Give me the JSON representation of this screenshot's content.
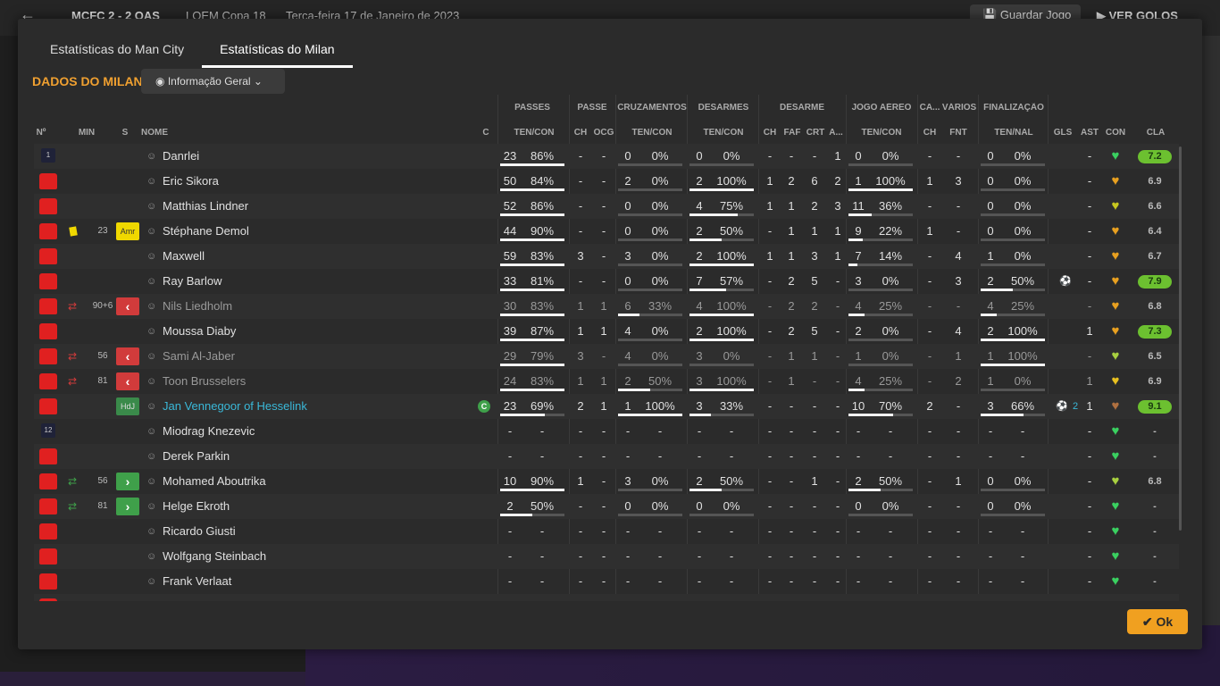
{
  "topbar": {
    "back_icon": "back-arrow-icon",
    "score": "MCFC  2 - 2  OAS",
    "competition": "LOEM Copa 18",
    "date": "Terça-feira 17 de Janeiro de 2023",
    "save_label": "Guardar Jogo",
    "goals_label": "VER GOLOS"
  },
  "tabs": [
    {
      "label": "Estatísticas do Man City",
      "active": false
    },
    {
      "label": "Estatísticas do Milan",
      "active": true
    }
  ],
  "section_title": "DADOS DO MILAN",
  "view_select": {
    "value": "Informação Geral",
    "icon": "eye-icon"
  },
  "groups": [
    "PASSES",
    "PASSE",
    "CRUZAMENTOS",
    "DESARMES",
    "DESARME",
    "JOGO AÉREO",
    "CA...",
    "VÁRIOS",
    "FINALIZAÇÃO"
  ],
  "columns": [
    "Nº",
    "MIN",
    "S",
    "NOME",
    "C",
    "TEN/CON",
    "CH",
    "OCG",
    "TEN/CON",
    "TEN/CON",
    "CH",
    "FAF",
    "CRT",
    "A...",
    "TEN/CON",
    "CH",
    "FNT",
    "TEN/NAL",
    "GLS",
    "AST",
    "CON",
    "CLA"
  ],
  "colors": {
    "accent": "#f0a030",
    "shirt": "#e02020",
    "sub_out": "#d13b3b",
    "sub_in": "#3fa04a",
    "rating_high": "#6cc030",
    "link": "#3ab8d8"
  },
  "players": [
    {
      "num": "1",
      "kit": "gk",
      "card": "",
      "min": "",
      "sub": "",
      "tag": "",
      "name": "Danrlei",
      "cap": "",
      "p": [
        "23",
        "86%"
      ],
      "ch": "-",
      "ocg": "-",
      "cr": [
        "0",
        "0%"
      ],
      "ds": [
        "0",
        "0%"
      ],
      "d": [
        "-",
        "-",
        "-",
        "1"
      ],
      "ja": [
        "0",
        "0%"
      ],
      "ca": "-",
      "fnt": "-",
      "fi": [
        "0",
        "0%"
      ],
      "gls": "",
      "ast": "-",
      "con": "#3ad060",
      "cla": "7.2",
      "cla_hi": true,
      "pb": 1,
      "crb": 0,
      "dsb": 0,
      "jab": 0,
      "fib": 0
    },
    {
      "num": "",
      "kit": "shirt",
      "card": "",
      "min": "",
      "sub": "",
      "tag": "",
      "name": "Eric Sikora",
      "cap": "",
      "p": [
        "50",
        "84%"
      ],
      "ch": "-",
      "ocg": "-",
      "cr": [
        "2",
        "0%"
      ],
      "ds": [
        "2",
        "100%"
      ],
      "d": [
        "1",
        "2",
        "6",
        "2"
      ],
      "ja": [
        "1",
        "100%"
      ],
      "ca": "1",
      "fnt": "3",
      "fi": [
        "0",
        "0%"
      ],
      "gls": "",
      "ast": "-",
      "con": "#e8a020",
      "cla": "6.9",
      "cla_hi": false,
      "pb": 1,
      "crb": 0,
      "dsb": 1,
      "jab": 1,
      "fib": 0
    },
    {
      "num": "",
      "kit": "shirt",
      "card": "",
      "min": "",
      "sub": "",
      "tag": "",
      "name": "Matthias Lindner",
      "cap": "",
      "p": [
        "52",
        "86%"
      ],
      "ch": "-",
      "ocg": "-",
      "cr": [
        "0",
        "0%"
      ],
      "ds": [
        "4",
        "75%"
      ],
      "d": [
        "1",
        "1",
        "2",
        "3"
      ],
      "ja": [
        "11",
        "36%"
      ],
      "ca": "-",
      "fnt": "-",
      "fi": [
        "0",
        "0%"
      ],
      "gls": "",
      "ast": "-",
      "con": "#c8c820",
      "cla": "6.6",
      "cla_hi": false,
      "pb": 1,
      "crb": 0,
      "dsb": 0.75,
      "jab": 0.36,
      "fib": 0
    },
    {
      "num": "",
      "kit": "shirt",
      "card": "yellow",
      "min": "23",
      "sub": "",
      "tag": "Amr",
      "name": "Stéphane Demol",
      "cap": "",
      "p": [
        "44",
        "90%"
      ],
      "ch": "-",
      "ocg": "-",
      "cr": [
        "0",
        "0%"
      ],
      "ds": [
        "2",
        "50%"
      ],
      "d": [
        "-",
        "1",
        "1",
        "1"
      ],
      "ja": [
        "9",
        "22%"
      ],
      "ca": "1",
      "fnt": "-",
      "fi": [
        "0",
        "0%"
      ],
      "gls": "",
      "ast": "-",
      "con": "#e8a020",
      "cla": "6.4",
      "cla_hi": false,
      "pb": 1,
      "crb": 0,
      "dsb": 0.5,
      "jab": 0.22,
      "fib": 0
    },
    {
      "num": "",
      "kit": "shirt",
      "card": "",
      "min": "",
      "sub": "",
      "tag": "",
      "name": "Maxwell",
      "cap": "",
      "p": [
        "59",
        "83%"
      ],
      "ch": "3",
      "ocg": "-",
      "cr": [
        "3",
        "0%"
      ],
      "ds": [
        "2",
        "100%"
      ],
      "d": [
        "1",
        "1",
        "3",
        "1"
      ],
      "ja": [
        "7",
        "14%"
      ],
      "ca": "-",
      "fnt": "4",
      "fi": [
        "1",
        "0%"
      ],
      "gls": "",
      "ast": "-",
      "con": "#e8a020",
      "cla": "6.7",
      "cla_hi": false,
      "pb": 1,
      "crb": 0,
      "dsb": 1,
      "jab": 0.14,
      "fib": 0
    },
    {
      "num": "",
      "kit": "shirt",
      "card": "",
      "min": "",
      "sub": "",
      "tag": "",
      "name": "Ray Barlow",
      "cap": "",
      "p": [
        "33",
        "81%"
      ],
      "ch": "-",
      "ocg": "-",
      "cr": [
        "0",
        "0%"
      ],
      "ds": [
        "7",
        "57%"
      ],
      "d": [
        "-",
        "2",
        "5",
        "-"
      ],
      "ja": [
        "3",
        "0%"
      ],
      "ca": "-",
      "fnt": "3",
      "fi": [
        "2",
        "50%"
      ],
      "gls": "ball",
      "ast": "-",
      "con": "#e8a020",
      "cla": "7.9",
      "cla_hi": true,
      "pb": 1,
      "crb": 0,
      "dsb": 0.57,
      "jab": 0,
      "fib": 0.5
    },
    {
      "num": "",
      "kit": "shirt",
      "card": "",
      "min": "90+6",
      "sub": "out",
      "tag": "",
      "name": "Nils Liedholm",
      "cap": "",
      "p": [
        "30",
        "83%"
      ],
      "ch": "1",
      "ocg": "1",
      "cr": [
        "6",
        "33%"
      ],
      "ds": [
        "4",
        "100%"
      ],
      "d": [
        "-",
        "2",
        "2",
        "-"
      ],
      "ja": [
        "4",
        "25%"
      ],
      "ca": "-",
      "fnt": "-",
      "fi": [
        "4",
        "25%"
      ],
      "gls": "",
      "ast": "-",
      "con": "#e8a020",
      "cla": "6.8",
      "cla_hi": false,
      "pb": 1,
      "crb": 0.33,
      "dsb": 1,
      "jab": 0.25,
      "fib": 0.25,
      "dim": true
    },
    {
      "num": "",
      "kit": "shirt",
      "card": "",
      "min": "",
      "sub": "",
      "tag": "",
      "name": "Moussa Diaby",
      "cap": "",
      "p": [
        "39",
        "87%"
      ],
      "ch": "1",
      "ocg": "1",
      "cr": [
        "4",
        "0%"
      ],
      "ds": [
        "2",
        "100%"
      ],
      "d": [
        "-",
        "2",
        "5",
        "-"
      ],
      "ja": [
        "2",
        "0%"
      ],
      "ca": "-",
      "fnt": "4",
      "fi": [
        "2",
        "100%"
      ],
      "gls": "",
      "ast": "1",
      "con": "#e8a020",
      "cla": "7.3",
      "cla_hi": true,
      "pb": 1,
      "crb": 0,
      "dsb": 1,
      "jab": 0,
      "fib": 1
    },
    {
      "num": "",
      "kit": "shirt",
      "card": "",
      "min": "56",
      "sub": "out",
      "tag": "",
      "name": "Sami Al-Jaber",
      "cap": "",
      "p": [
        "29",
        "79%"
      ],
      "ch": "3",
      "ocg": "-",
      "cr": [
        "4",
        "0%"
      ],
      "ds": [
        "3",
        "0%"
      ],
      "d": [
        "-",
        "1",
        "1",
        "-"
      ],
      "ja": [
        "1",
        "0%"
      ],
      "ca": "-",
      "fnt": "1",
      "fi": [
        "1",
        "100%"
      ],
      "gls": "",
      "ast": "-",
      "con": "#a8d040",
      "cla": "6.5",
      "cla_hi": false,
      "pb": 1,
      "crb": 0,
      "dsb": 0,
      "jab": 0,
      "fib": 1,
      "dim": true
    },
    {
      "num": "",
      "kit": "shirt",
      "card": "",
      "min": "81",
      "sub": "out",
      "tag": "",
      "name": "Toon Brusselers",
      "cap": "",
      "p": [
        "24",
        "83%"
      ],
      "ch": "1",
      "ocg": "1",
      "cr": [
        "2",
        "50%"
      ],
      "ds": [
        "3",
        "100%"
      ],
      "d": [
        "-",
        "1",
        "-",
        "-"
      ],
      "ja": [
        "4",
        "25%"
      ],
      "ca": "-",
      "fnt": "2",
      "fi": [
        "1",
        "0%"
      ],
      "gls": "",
      "ast": "1",
      "con": "#e8c020",
      "cla": "6.9",
      "cla_hi": false,
      "pb": 1,
      "crb": 0.5,
      "dsb": 1,
      "jab": 0.25,
      "fib": 0,
      "dim": true
    },
    {
      "num": "",
      "kit": "shirt",
      "card": "",
      "min": "",
      "sub": "",
      "tag": "HdJ",
      "name": "Jan Vennegoor of Hesselink",
      "cap": "C",
      "p": [
        "23",
        "69%"
      ],
      "ch": "2",
      "ocg": "1",
      "cr": [
        "1",
        "100%"
      ],
      "ds": [
        "3",
        "33%"
      ],
      "d": [
        "-",
        "-",
        "-",
        "-"
      ],
      "ja": [
        "10",
        "70%"
      ],
      "ca": "2",
      "fnt": "-",
      "fi": [
        "3",
        "66%"
      ],
      "gls": "ball2",
      "ast": "1",
      "con": "#b07040",
      "cla": "9.1",
      "cla_hi": true,
      "pb": 0.69,
      "crb": 1,
      "dsb": 0.33,
      "jab": 0.7,
      "fib": 0.66,
      "link": true
    },
    {
      "num": "12",
      "kit": "gk",
      "card": "",
      "min": "",
      "sub": "",
      "tag": "",
      "name": "Miodrag Knezevic",
      "cap": "",
      "p": [
        "-",
        "-"
      ],
      "ch": "-",
      "ocg": "-",
      "cr": [
        "-",
        "-"
      ],
      "ds": [
        "-",
        "-"
      ],
      "d": [
        "-",
        "-",
        "-",
        "-"
      ],
      "ja": [
        "-",
        "-"
      ],
      "ca": "-",
      "fnt": "-",
      "fi": [
        "-",
        "-"
      ],
      "gls": "",
      "ast": "-",
      "con": "#3ad060",
      "cla": "-",
      "cla_hi": false,
      "pb": 0,
      "crb": 0,
      "dsb": 0,
      "jab": 0,
      "fib": 0
    },
    {
      "num": "",
      "kit": "shirt",
      "card": "",
      "min": "",
      "sub": "",
      "tag": "",
      "name": "Derek Parkin",
      "cap": "",
      "p": [
        "-",
        "-"
      ],
      "ch": "-",
      "ocg": "-",
      "cr": [
        "-",
        "-"
      ],
      "ds": [
        "-",
        "-"
      ],
      "d": [
        "-",
        "-",
        "-",
        "-"
      ],
      "ja": [
        "-",
        "-"
      ],
      "ca": "-",
      "fnt": "-",
      "fi": [
        "-",
        "-"
      ],
      "gls": "",
      "ast": "-",
      "con": "#3ad060",
      "cla": "-",
      "cla_hi": false,
      "pb": 0,
      "crb": 0,
      "dsb": 0,
      "jab": 0,
      "fib": 0
    },
    {
      "num": "",
      "kit": "shirt",
      "card": "",
      "min": "56",
      "sub": "in",
      "tag": "",
      "name": "Mohamed Aboutrika",
      "cap": "",
      "p": [
        "10",
        "90%"
      ],
      "ch": "1",
      "ocg": "-",
      "cr": [
        "3",
        "0%"
      ],
      "ds": [
        "2",
        "50%"
      ],
      "d": [
        "-",
        "-",
        "1",
        "-"
      ],
      "ja": [
        "2",
        "50%"
      ],
      "ca": "-",
      "fnt": "1",
      "fi": [
        "0",
        "0%"
      ],
      "gls": "",
      "ast": "-",
      "con": "#a8d040",
      "cla": "6.8",
      "cla_hi": false,
      "pb": 1,
      "crb": 0,
      "dsb": 0.5,
      "jab": 0.5,
      "fib": 0
    },
    {
      "num": "",
      "kit": "shirt",
      "card": "",
      "min": "81",
      "sub": "in",
      "tag": "",
      "name": "Helge Ekroth",
      "cap": "",
      "p": [
        "2",
        "50%"
      ],
      "ch": "-",
      "ocg": "-",
      "cr": [
        "0",
        "0%"
      ],
      "ds": [
        "0",
        "0%"
      ],
      "d": [
        "-",
        "-",
        "-",
        "-"
      ],
      "ja": [
        "0",
        "0%"
      ],
      "ca": "-",
      "fnt": "-",
      "fi": [
        "0",
        "0%"
      ],
      "gls": "",
      "ast": "-",
      "con": "#3ad060",
      "cla": "-",
      "cla_hi": false,
      "pb": 0.5,
      "crb": 0,
      "dsb": 0,
      "jab": 0,
      "fib": 0
    },
    {
      "num": "",
      "kit": "shirt",
      "card": "",
      "min": "",
      "sub": "",
      "tag": "",
      "name": "Ricardo Giusti",
      "cap": "",
      "p": [
        "-",
        "-"
      ],
      "ch": "-",
      "ocg": "-",
      "cr": [
        "-",
        "-"
      ],
      "ds": [
        "-",
        "-"
      ],
      "d": [
        "-",
        "-",
        "-",
        "-"
      ],
      "ja": [
        "-",
        "-"
      ],
      "ca": "-",
      "fnt": "-",
      "fi": [
        "-",
        "-"
      ],
      "gls": "",
      "ast": "-",
      "con": "#3ad060",
      "cla": "-",
      "cla_hi": false,
      "pb": 0,
      "crb": 0,
      "dsb": 0,
      "jab": 0,
      "fib": 0
    },
    {
      "num": "",
      "kit": "shirt",
      "card": "",
      "min": "",
      "sub": "",
      "tag": "",
      "name": "Wolfgang Steinbach",
      "cap": "",
      "p": [
        "-",
        "-"
      ],
      "ch": "-",
      "ocg": "-",
      "cr": [
        "-",
        "-"
      ],
      "ds": [
        "-",
        "-"
      ],
      "d": [
        "-",
        "-",
        "-",
        "-"
      ],
      "ja": [
        "-",
        "-"
      ],
      "ca": "-",
      "fnt": "-",
      "fi": [
        "-",
        "-"
      ],
      "gls": "",
      "ast": "-",
      "con": "#3ad060",
      "cla": "-",
      "cla_hi": false,
      "pb": 0,
      "crb": 0,
      "dsb": 0,
      "jab": 0,
      "fib": 0
    },
    {
      "num": "",
      "kit": "shirt",
      "card": "",
      "min": "",
      "sub": "",
      "tag": "",
      "name": "Frank Verlaat",
      "cap": "",
      "p": [
        "-",
        "-"
      ],
      "ch": "-",
      "ocg": "-",
      "cr": [
        "-",
        "-"
      ],
      "ds": [
        "-",
        "-"
      ],
      "d": [
        "-",
        "-",
        "-",
        "-"
      ],
      "ja": [
        "-",
        "-"
      ],
      "ca": "-",
      "fnt": "-",
      "fi": [
        "-",
        "-"
      ],
      "gls": "",
      "ast": "-",
      "con": "#3ad060",
      "cla": "-",
      "cla_hi": false,
      "pb": 0,
      "crb": 0,
      "dsb": 0,
      "jab": 0,
      "fib": 0
    },
    {
      "num": "",
      "kit": "shirt",
      "card": "",
      "min": "",
      "sub": "",
      "tag": "",
      "name": "",
      "cap": "",
      "p": [
        "-",
        "-"
      ],
      "ch": "-",
      "ocg": "-",
      "cr": [
        "-",
        "-"
      ],
      "ds": [
        "-",
        "-"
      ],
      "d": [
        "-",
        "-",
        "-",
        "-"
      ],
      "ja": [
        "-",
        "-"
      ],
      "ca": "-",
      "fnt": "-",
      "fi": [
        "-",
        "-"
      ],
      "gls": "",
      "ast": "-",
      "con": "#3ad060",
      "cla": "-",
      "cla_hi": false,
      "pb": 0,
      "crb": 0,
      "dsb": 0,
      "jab": 0,
      "fib": 0
    }
  ],
  "ok_label": "Ok"
}
